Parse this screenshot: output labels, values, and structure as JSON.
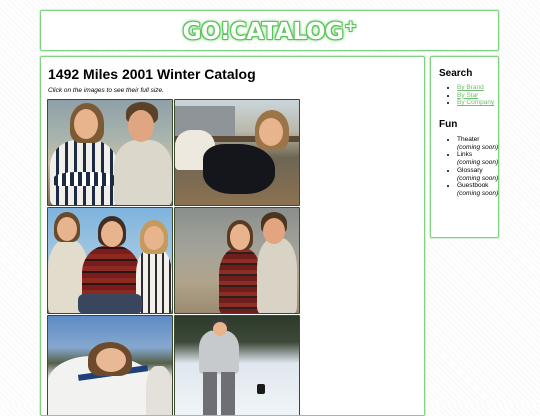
{
  "header": {
    "logo_text": "GO!CATALOG",
    "logo_mark": "+"
  },
  "main": {
    "title": "1492 Miles 2001 Winter Catalog",
    "subtitle": "Click on the images to see their full size.",
    "images": [
      {
        "name": "catalog-image-1",
        "scene": "couple-outdoors"
      },
      {
        "name": "catalog-image-2",
        "scene": "woman-on-fence"
      },
      {
        "name": "catalog-image-3",
        "scene": "group-of-three"
      },
      {
        "name": "catalog-image-4",
        "scene": "couple-standing"
      },
      {
        "name": "catalog-image-5",
        "scene": "woman-in-snow"
      },
      {
        "name": "catalog-image-6",
        "scene": "skier-on-slope"
      }
    ]
  },
  "sidebar": {
    "search_heading": "Search",
    "search_links": [
      "By Brand",
      "By Star",
      "By Company"
    ],
    "fun_heading": "Fun",
    "fun_items": [
      {
        "label": "Theater",
        "note": "(coming soon)"
      },
      {
        "label": "Links",
        "note": "(coming soon)"
      },
      {
        "label": "Glossary",
        "note": "(coming soon)"
      },
      {
        "label": "Guestbook",
        "note": "(coming soon)"
      }
    ]
  },
  "colors": {
    "accent": "#7fd27f",
    "link": "#6cbf6c",
    "logo_glow": "#4bbf4b"
  }
}
